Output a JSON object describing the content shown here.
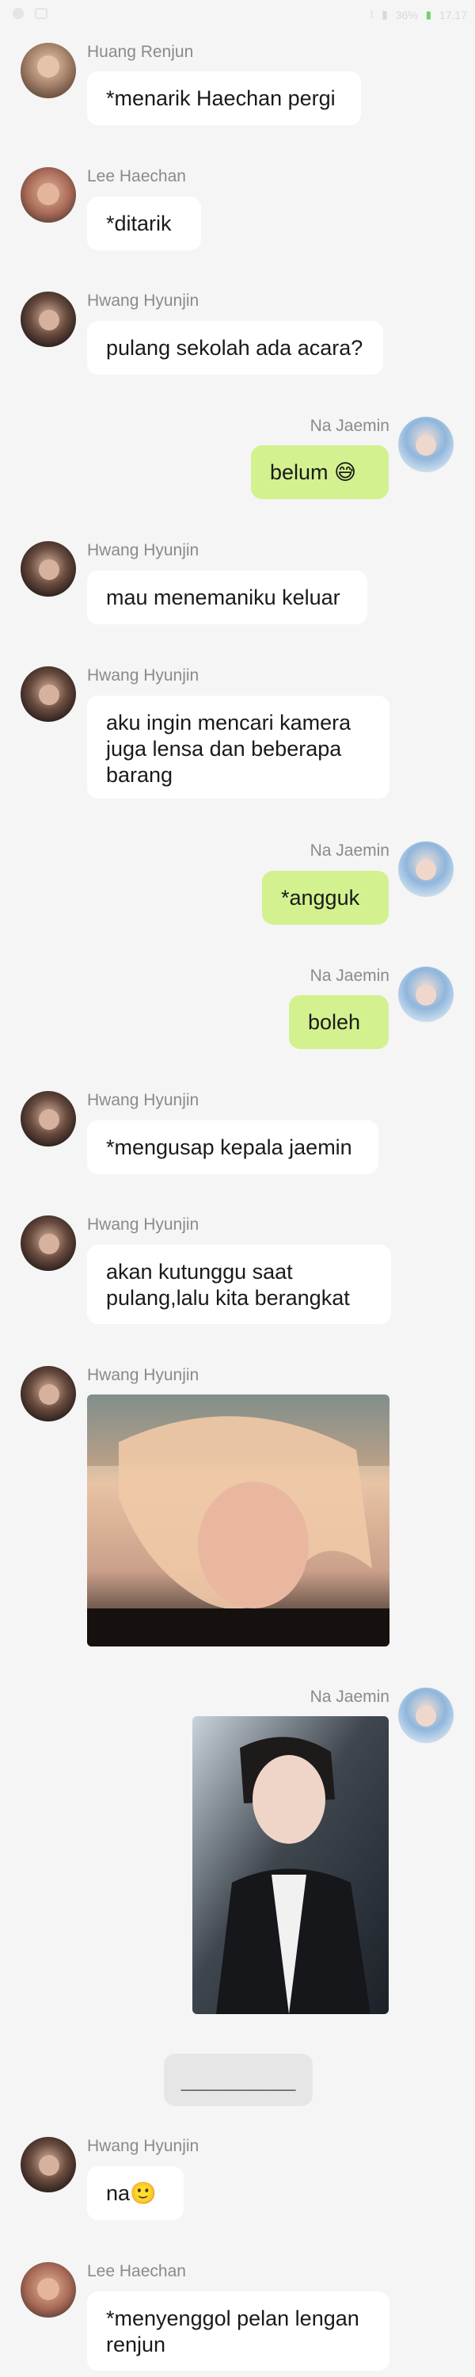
{
  "status_bar": {
    "battery": "36%",
    "time": "17.17"
  },
  "messages": [
    {
      "sender": "Huang Renjun",
      "text": "*menarik Haechan pergi"
    },
    {
      "sender": "Lee Haechan",
      "text": "*ditarik"
    },
    {
      "sender": "Hwang Hyunjin",
      "text": "pulang sekolah ada acara?"
    },
    {
      "sender": "Na Jaemin",
      "text": "belum 😅"
    },
    {
      "sender": "Hwang Hyunjin",
      "text": "mau menemaniku keluar"
    },
    {
      "sender": "Hwang Hyunjin",
      "text": "aku ingin mencari kamera\njuga lensa dan beberapa\nbarang"
    },
    {
      "sender": "Na Jaemin",
      "text": "*angguk"
    },
    {
      "sender": "Na Jaemin",
      "text": "boleh"
    },
    {
      "sender": "Hwang Hyunjin",
      "text": "*mengusap kepala jaemin"
    },
    {
      "sender": "Hwang Hyunjin",
      "text": "akan kutunggu saat\npulang,lalu kita berangkat"
    },
    {
      "sender": "Hwang Hyunjin",
      "photo": "hyunjin-photo"
    },
    {
      "sender": "Na Jaemin",
      "photo": "jaemin-photo"
    },
    {
      "divider": "__________"
    },
    {
      "sender": "Hwang Hyunjin",
      "text": "na🙂"
    },
    {
      "sender": "Lee Haechan",
      "text": "*menyenggol pelan lengan\nrenjun"
    }
  ]
}
